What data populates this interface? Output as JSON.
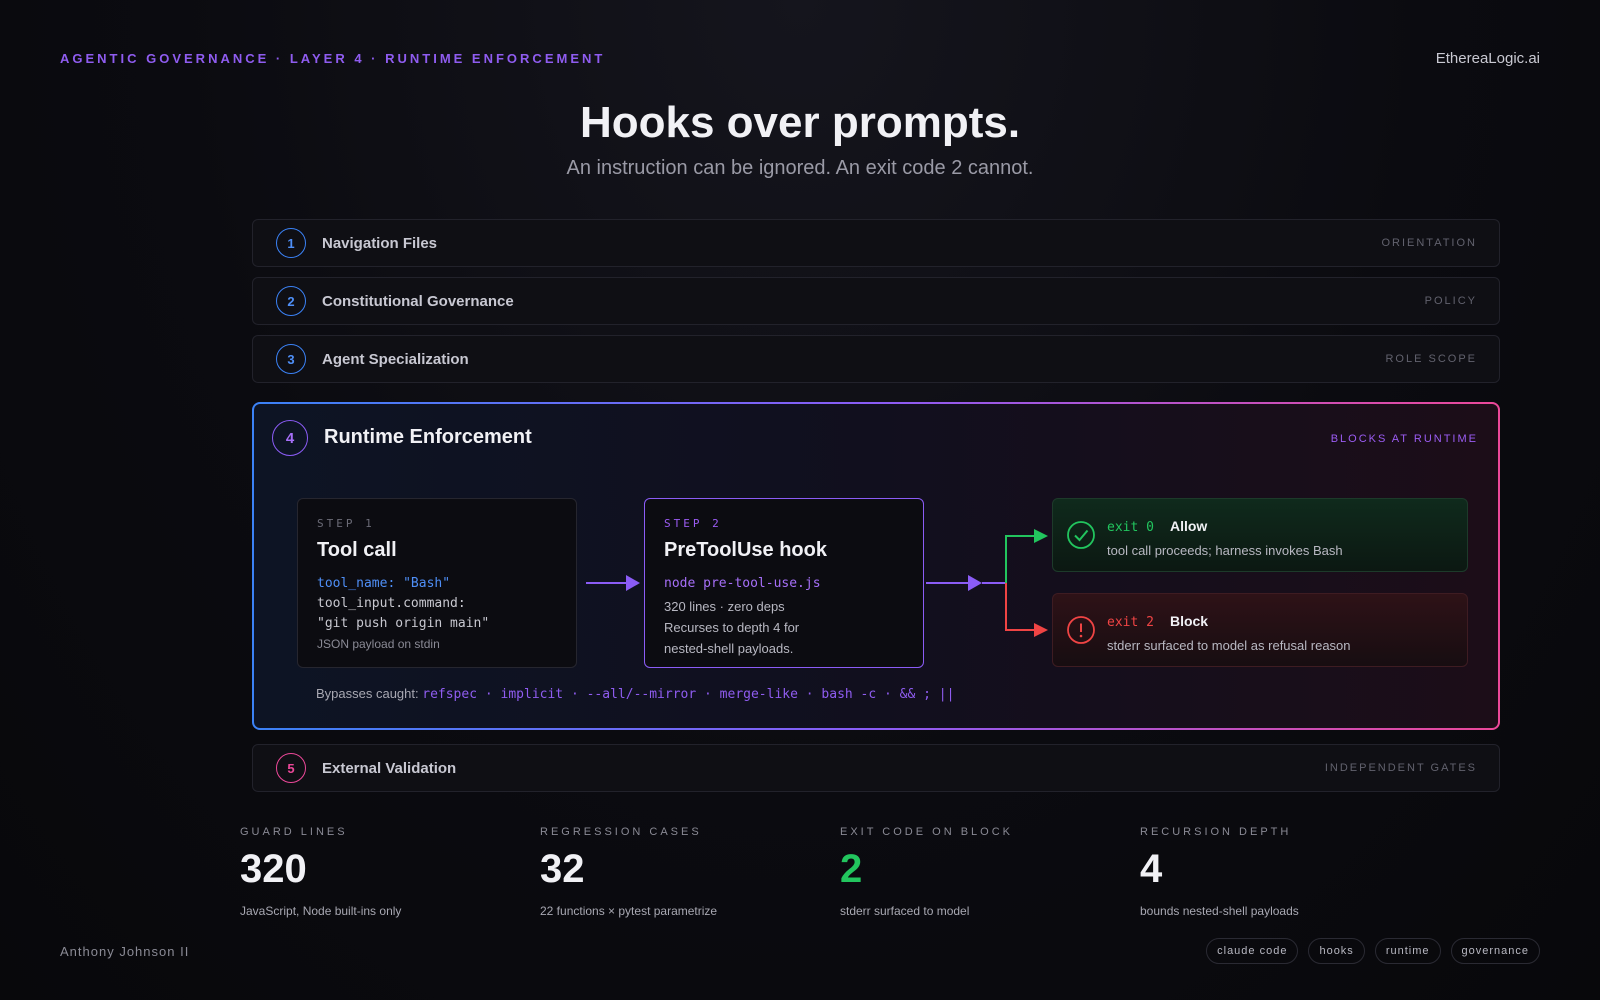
{
  "header": {
    "eyebrow": "AGENTIC GOVERNANCE · LAYER 4 · RUNTIME ENFORCEMENT",
    "brand": "EthereaLogic.ai",
    "title": "Hooks over prompts.",
    "subtitle": "An instruction can be ignored. An exit code 2 cannot."
  },
  "layers": [
    {
      "number": "1",
      "title": "Navigation Files",
      "tag": "ORIENTATION",
      "color": "#3b82f6"
    },
    {
      "number": "2",
      "title": "Constitutional Governance",
      "tag": "POLICY",
      "color": "#3b82f6"
    },
    {
      "number": "3",
      "title": "Agent Specialization",
      "tag": "ROLE SCOPE",
      "color": "#3b82f6"
    },
    {
      "number": "4",
      "title": "Runtime Enforcement",
      "tag": "BLOCKS AT RUNTIME",
      "color": "#8b5cf6"
    },
    {
      "number": "5",
      "title": "External Validation",
      "tag": "INDEPENDENT GATES",
      "color": "#ec4899"
    }
  ],
  "flow": {
    "step1": {
      "label": "STEP 1",
      "title": "Tool call",
      "code1": "tool_name: \"Bash\"",
      "code2": "tool_input.command:",
      "code3": "\"git push origin main\"",
      "note": "JSON payload on stdin"
    },
    "step2": {
      "label": "STEP 2",
      "title": "PreToolUse hook",
      "code": "node pre-tool-use.js",
      "line1": "320 lines · zero deps",
      "line2": "Recurses to depth 4 for",
      "line3": "nested-shell payloads."
    },
    "allow": {
      "exit": "exit 0",
      "name": "Allow",
      "desc": "tool call proceeds; harness invokes Bash",
      "color": "#22c55e"
    },
    "block": {
      "exit": "exit 2",
      "name": "Block",
      "desc": "stderr surfaced to model as refusal reason",
      "color": "#ef4444"
    },
    "bypass_label": "Bypasses caught:",
    "bypass_items": "refspec · implicit · --all/--mirror · merge-like · bash -c · && ; ||"
  },
  "stats": [
    {
      "label": "GUARD LINES",
      "value": "320",
      "desc": "JavaScript, Node built-ins only"
    },
    {
      "label": "REGRESSION CASES",
      "value": "32",
      "desc": "22 functions × pytest parametrize"
    },
    {
      "label": "EXIT CODE ON BLOCK",
      "value": "2",
      "desc": "stderr surfaced to model"
    },
    {
      "label": "RECURSION DEPTH",
      "value": "4",
      "desc": "bounds nested-shell payloads"
    }
  ],
  "footer": {
    "author": "Anthony Johnson II",
    "tags": [
      "claude code",
      "hooks",
      "runtime",
      "governance"
    ]
  }
}
